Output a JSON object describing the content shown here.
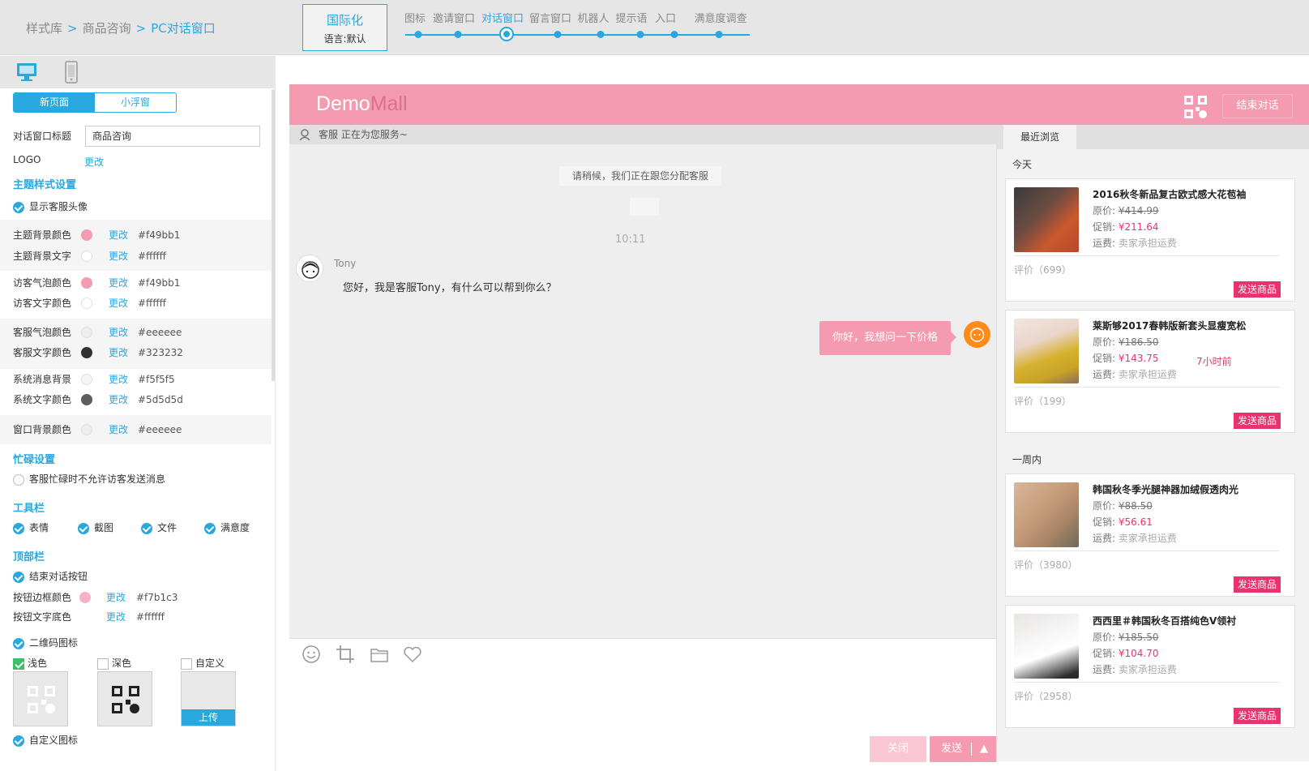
{
  "topbar": {
    "breadcrumb": [
      "样式库",
      "商品咨询",
      "PC对话窗口"
    ],
    "sep": ">",
    "intl_title": "国际化",
    "intl_lang": "语言:默认",
    "steps": [
      "图标",
      "邀请窗口",
      "对话窗口",
      "留言窗口",
      "机器人",
      "提示语",
      "入口",
      "满意度调查"
    ],
    "active_step": "对话窗口"
  },
  "left": {
    "mode_tabs": [
      "新页面",
      "小浮窗"
    ],
    "title_label": "对话窗口标题",
    "title_value": "商品咨询",
    "logo_label": "LOGO",
    "change": "更改",
    "theme_section": "主题样式设置",
    "show_avatar": "显示客服头像",
    "colors": [
      {
        "label": "主题背景颜色",
        "hex": "#f49bb1"
      },
      {
        "label": "主题背景文字",
        "hex": "#ffffff"
      },
      {
        "label": "访客气泡颜色",
        "hex": "#f49bb1"
      },
      {
        "label": "访客文字颜色",
        "hex": "#ffffff"
      },
      {
        "label": "客服气泡颜色",
        "hex": "#eeeeee"
      },
      {
        "label": "客服文字颜色",
        "hex": "#323232"
      },
      {
        "label": "系统消息背景",
        "hex": "#f5f5f5"
      },
      {
        "label": "系统文字颜色",
        "hex": "#5d5d5d"
      },
      {
        "label": "窗口背景颜色",
        "hex": "#eeeeee"
      }
    ],
    "busy_section": "忙碌设置",
    "busy_option": "客服忙碌时不允许访客发送消息",
    "toolbar_section": "工具栏",
    "toolbar_options": [
      "表情",
      "截图",
      "文件",
      "满意度"
    ],
    "topbar_section": "顶部栏",
    "end_button_option": "结束对话按钮",
    "btn_border_label": "按钮边框颜色",
    "btn_border_hex": "#f7b1c3",
    "btn_text_label": "按钮文字底色",
    "btn_text_hex": "#ffffff",
    "qr_option": "二维码图标",
    "qr_styles": [
      "浅色",
      "深色",
      "自定义"
    ],
    "upload": "上传",
    "custom_icon": "自定义图标"
  },
  "preview": {
    "logo_demo": "Demo",
    "logo_mall": "Mall",
    "end_button": "结束对话",
    "status": "客服 正在为您服务~",
    "system_msg": "请稍候，我们正在跟您分配客服",
    "time": "10:11",
    "agent_name": "Tony",
    "agent_msg": "您好，我是客服Tony，有什么可以帮到你么？",
    "visitor_msg": "你好，我想问一下价格",
    "close": "关闭",
    "send": "发送",
    "send_arrow": "▲",
    "sidebar_tab": "最近浏览",
    "group_today": "今天",
    "group_week": "一周内",
    "products": [
      {
        "name": "2016秋冬新品复古欧式感大花苞袖",
        "orig_label": "原价:",
        "orig": "¥414.99",
        "promo_label": "促销:",
        "promo": "¥211.64",
        "ship_label": "运费:",
        "ship": "卖家承担运费",
        "reviews": "评价（699）",
        "send": "发送商品",
        "ago": ""
      },
      {
        "name": "莱斯够2017春韩版新套头显瘦宽松",
        "orig_label": "原价:",
        "orig": "¥186.50",
        "promo_label": "促销:",
        "promo": "¥143.75",
        "ship_label": "运费:",
        "ship": "卖家承担运费",
        "reviews": "评价（199）",
        "send": "发送商品",
        "ago": "7小时前"
      },
      {
        "name": "韩国秋冬季光腿神器加绒假透肉光",
        "orig_label": "原价:",
        "orig": "¥88.50",
        "promo_label": "促销:",
        "promo": "¥56.61",
        "ship_label": "运费:",
        "ship": "卖家承担运费",
        "reviews": "评价（3980）",
        "send": "发送商品",
        "ago": ""
      },
      {
        "name": "西西里＃韩国秋冬百搭纯色V领衬",
        "orig_label": "原价:",
        "orig": "¥185.50",
        "promo_label": "促销:",
        "promo": "¥104.70",
        "ship_label": "运费:",
        "ship": "卖家承担运费",
        "reviews": "评价（2958）",
        "send": "发送商品",
        "ago": ""
      }
    ]
  }
}
